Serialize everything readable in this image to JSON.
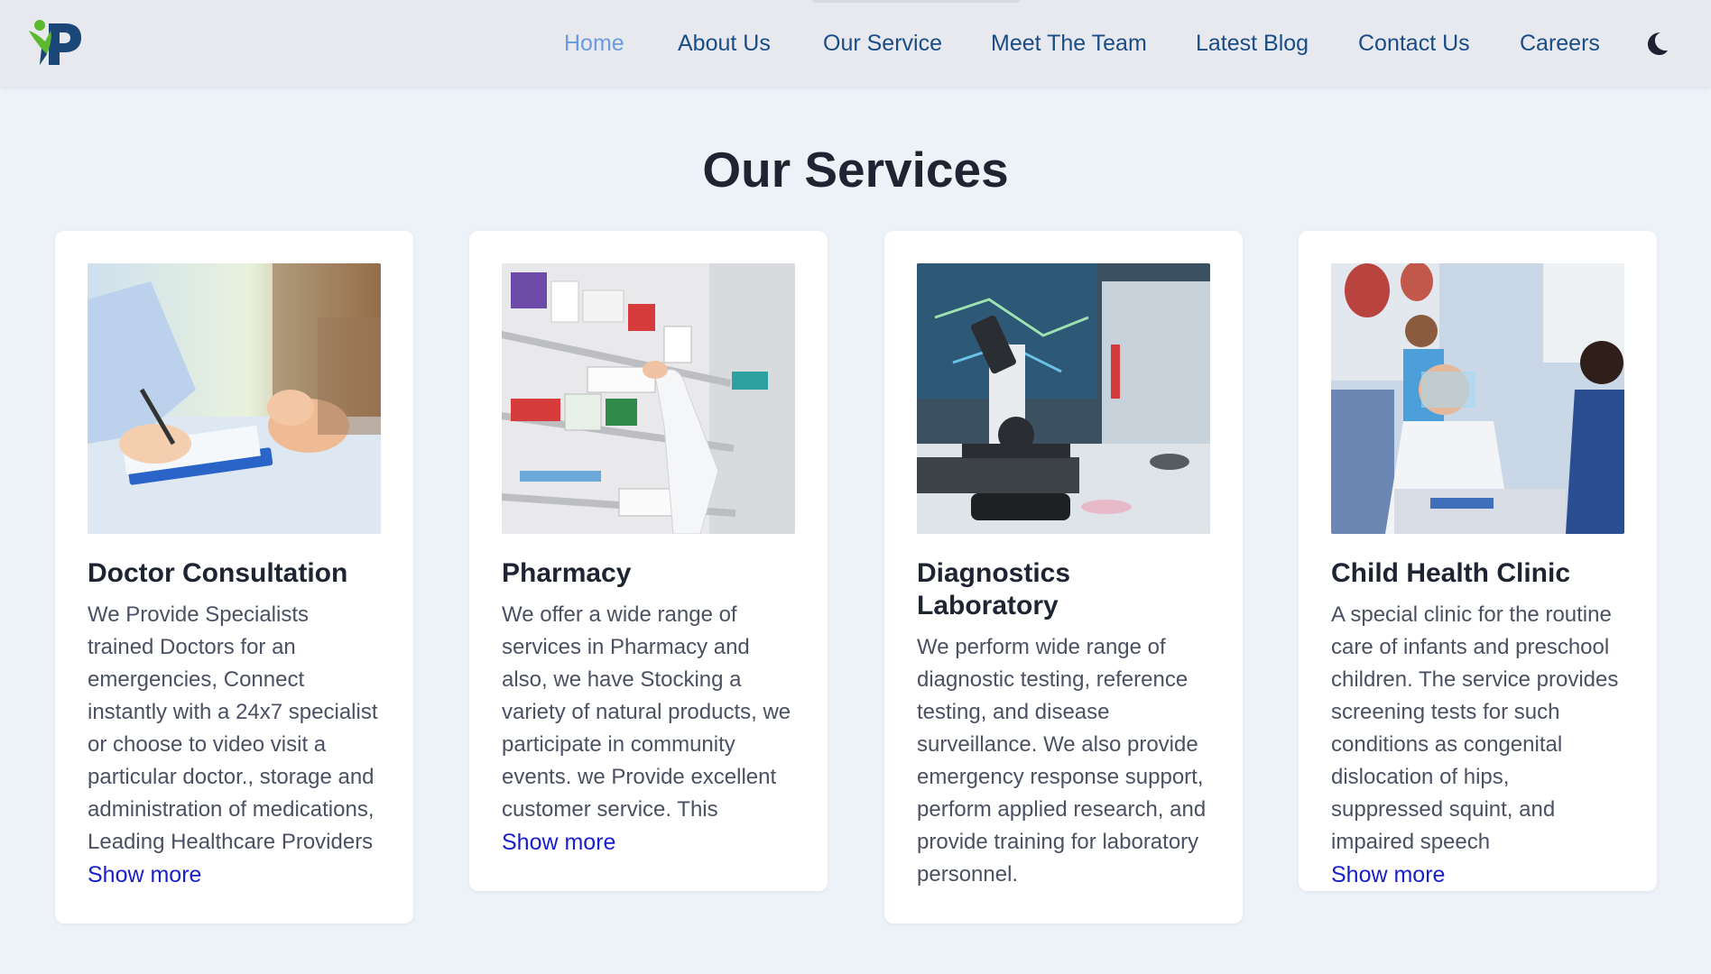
{
  "header": {
    "nav": [
      {
        "label": "Home",
        "active": true
      },
      {
        "label": "About Us"
      },
      {
        "label": "Our Service"
      },
      {
        "label": "Meet The Team"
      },
      {
        "label": "Latest Blog"
      },
      {
        "label": "Contact Us"
      },
      {
        "label": "Careers"
      }
    ],
    "theme_toggle_icon": "moon-icon",
    "logo_icon": "tp-logo-icon"
  },
  "services": {
    "title": "Our Services",
    "cards": [
      {
        "title": "Doctor Consultation",
        "description": "We Provide Specialists trained Doctors for an emergencies, Connect instantly with a 24x7 specialist or choose to video visit a particular doctor., storage and administration of medications, Leading Healthcare Providers",
        "show_more": "Show more",
        "image": "doctor-consultation-image"
      },
      {
        "title": "Pharmacy",
        "description": "We offer a wide range of services in Pharmacy and also, we have Stocking a variety of natural products, we participate in community events. we Provide excellent customer service. This",
        "show_more": "Show more",
        "image": "pharmacy-shelves-image"
      },
      {
        "title": "Diagnostics Laboratory",
        "description": "We perform wide range of diagnostic testing, reference testing, and disease surveillance. We also provide emergency response support, perform applied research, and provide training for laboratory personnel.",
        "show_more": "",
        "image": "microscope-lab-image"
      },
      {
        "title": "Child Health Clinic",
        "description": "A special clinic for the routine care of infants and preschool children. The service provides screening tests for such conditions as congenital dislocation of hips, suppressed squint, and impaired speech",
        "show_more": "Show more",
        "image": "child-clinic-image"
      }
    ]
  },
  "colors": {
    "page_bg": "#edf1f8",
    "nav_link": "#1a4d86",
    "nav_active": "#6b9bdc",
    "link": "#1a20c8",
    "logo_green": "#5cb82e",
    "logo_navy": "#1a4678"
  }
}
